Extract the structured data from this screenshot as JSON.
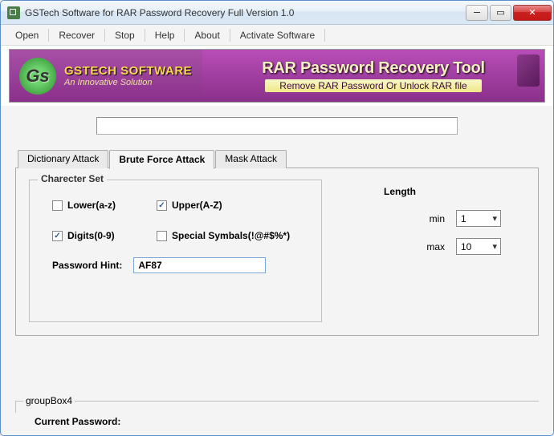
{
  "window": {
    "title": "GSTech Software  for RAR Password Recovery Full Version 1.0"
  },
  "menu": {
    "items": [
      "Open",
      "Recover",
      "Stop",
      "Help",
      "About",
      "Activate Software"
    ]
  },
  "banner": {
    "logo_letters": "Gs",
    "brand_name": "GSTECH SOFTWARE",
    "brand_tag": "An Innovative Solution",
    "title": "RAR Password Recovery Tool",
    "subtitle": "Remove RAR Password Or Unlock RAR file"
  },
  "tabs": {
    "items": [
      "Dictionary Attack",
      "Brute Force Attack",
      "Mask Attack"
    ],
    "active_index": 1
  },
  "charset": {
    "legend": "Charecter Set",
    "lower": {
      "label": "Lower(a-z)",
      "checked": false
    },
    "upper": {
      "label": "Upper(A-Z)",
      "checked": true
    },
    "digits": {
      "label": "Digits(0-9)",
      "checked": true
    },
    "special": {
      "label": "Special Symbals(!@#$%*)",
      "checked": false
    },
    "hint_label": "Password Hint:",
    "hint_value": "AF87"
  },
  "length": {
    "title": "Length",
    "min_label": "min",
    "min_value": "1",
    "max_label": "max",
    "max_value": "10"
  },
  "bottom": {
    "groupbox_label": "groupBox4",
    "current_password_label": "Current Password:"
  }
}
